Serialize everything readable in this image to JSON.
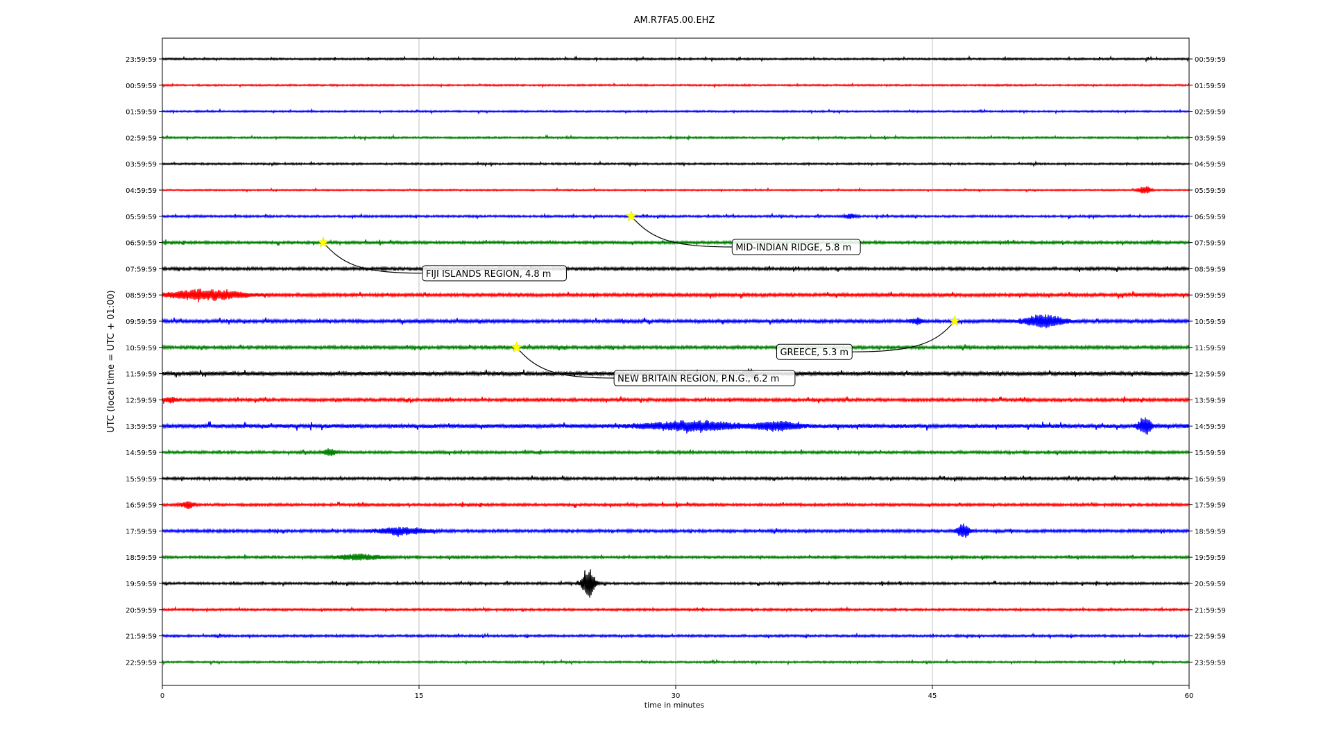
{
  "chart_data": {
    "type": "line",
    "title": "AM.R7FA5.00.EHZ",
    "xlabel": "time in minutes",
    "ylabel": "UTC (local time = UTC + 01:00)",
    "xlim": [
      0,
      60
    ],
    "x_ticks": [
      0,
      15,
      30,
      45,
      60
    ],
    "x_tick_labels": [
      "0",
      "15",
      "30",
      "45",
      "60"
    ],
    "grid": "vertical at x ticks",
    "trace_colors": [
      "#000000",
      "#ff0000",
      "#0000ff",
      "#008000"
    ],
    "rows_left_labels": [
      "23:59:59",
      "00:59:59",
      "01:59:59",
      "02:59:59",
      "03:59:59",
      "04:59:59",
      "05:59:59",
      "06:59:59",
      "07:59:59",
      "08:59:59",
      "09:59:59",
      "10:59:59",
      "11:59:59",
      "12:59:59",
      "13:59:59",
      "14:59:59",
      "15:59:59",
      "16:59:59",
      "17:59:59",
      "18:59:59",
      "19:59:59",
      "20:59:59",
      "21:59:59",
      "22:59:59"
    ],
    "rows_right_labels": [
      "00:59:59",
      "01:59:59",
      "02:59:59",
      "03:59:59",
      "04:59:59",
      "05:59:59",
      "06:59:59",
      "07:59:59",
      "08:59:59",
      "09:59:59",
      "10:59:59",
      "11:59:59",
      "12:59:59",
      "13:59:59",
      "14:59:59",
      "15:59:59",
      "16:59:59",
      "17:59:59",
      "18:59:59",
      "19:59:59",
      "20:59:59",
      "21:59:59",
      "22:59:59",
      "23:59:59"
    ],
    "row_noise_level": [
      0.9,
      0.8,
      0.8,
      0.9,
      0.9,
      0.7,
      1.0,
      1.3,
      1.4,
      1.6,
      1.6,
      1.5,
      1.8,
      1.5,
      2.0,
      1.3,
      1.3,
      1.3,
      1.4,
      1.2,
      1.1,
      1.1,
      1.1,
      0.9
    ],
    "bursts": [
      {
        "row": 5,
        "x": 57.4,
        "amp": 6
      },
      {
        "row": 6,
        "x": 40.2,
        "amp": 3
      },
      {
        "row": 9,
        "x": 2.5,
        "amp": 7,
        "width": 1.5
      },
      {
        "row": 10,
        "x": 51.5,
        "amp": 9,
        "width": 0.8
      },
      {
        "row": 10,
        "x": 44.1,
        "amp": 4
      },
      {
        "row": 13,
        "x": 0.5,
        "amp": 3
      },
      {
        "row": 14,
        "x": 57.4,
        "amp": 14
      },
      {
        "row": 14,
        "x": 31.0,
        "amp": 6,
        "width": 2.0
      },
      {
        "row": 14,
        "x": 36.0,
        "amp": 6,
        "width": 0.8
      },
      {
        "row": 15,
        "x": 9.8,
        "amp": 5
      },
      {
        "row": 17,
        "x": 1.5,
        "amp": 5
      },
      {
        "row": 18,
        "x": 46.8,
        "amp": 10
      },
      {
        "row": 18,
        "x": 14.0,
        "amp": 5,
        "width": 1.0
      },
      {
        "row": 19,
        "x": 11.5,
        "amp": 4,
        "width": 1.0
      },
      {
        "row": 20,
        "x": 24.9,
        "amp": 22
      },
      {
        "row": 12,
        "x": 34.3,
        "amp": 6
      }
    ],
    "events": [
      {
        "row": 6,
        "x": 27.4,
        "label": "MID-INDIAN RIDGE, 5.8 m",
        "label_x": 33.5,
        "label_row": 7.17
      },
      {
        "row": 7,
        "x": 9.4,
        "label": "FIJI ISLANDS REGION, 4.8 m",
        "label_x": 15.4,
        "label_row": 8.17
      },
      {
        "row": 10,
        "x": 46.3,
        "label": "GREECE, 5.3 m",
        "label_x": 36.1,
        "label_row": 11.17
      },
      {
        "row": 11,
        "x": 20.7,
        "label": "NEW BRITAIN REGION, P.N.G., 6.2 m",
        "label_x": 26.6,
        "label_row": 12.17
      }
    ],
    "marker_color": "#ffff00"
  }
}
